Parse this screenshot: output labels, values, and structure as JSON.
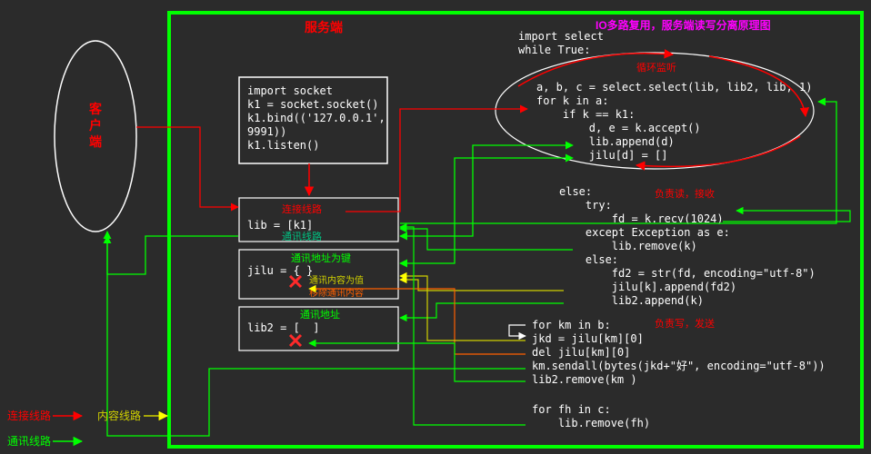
{
  "title_server": "服务端",
  "title_top_right": "IO多路复用，服务端读写分离原理图",
  "client_label": "客户端",
  "code_block1": {
    "l1": "import socket",
    "l2": "k1 = socket.socket()",
    "l3": "k1.bind(('127.0.0.1',",
    "l4": "9991))",
    "l5": "k1.listen()"
  },
  "mid": {
    "conn_line": "连接线路",
    "lib_line": "lib = [k1]",
    "comm_line": "通讯线路",
    "comm_addr_key": "通讯地址为键",
    "jilu_line": "jilu = { }",
    "comm_content_value": "通讯内容为值",
    "remove_comm_content": "移除通讯内容",
    "comm_addr": "通讯地址",
    "lib2_line": "lib2 = [  ]"
  },
  "top_code": {
    "l1": "import select",
    "l2": "while True:"
  },
  "ellipse": {
    "loop_label": "循环监听",
    "l1": "a, b, c = select.select(lib, lib2, lib, 1)",
    "l2": "for k in a:",
    "l3": "    if k == k1:",
    "l4": "        d, e = k.accept()",
    "l5": "        lib.append(d)",
    "l6": "        jilu[d] = []"
  },
  "block_read": {
    "else_label": "else:",
    "responsible_read": "负责读，接收",
    "l1": "    try:",
    "l2": "        fd = k.recv(1024)",
    "l3": "    except Exception as e:",
    "l4": "        lib.remove(k)",
    "l5": "    else:",
    "l6": "        fd2 = str(fd, encoding=\"utf-8\")",
    "l7": "        jilu[k].append(fd2)",
    "l8": "        lib2.append(k)"
  },
  "block_write": {
    "responsible_write": "负责写，发送",
    "l1": "for km in b:",
    "l2": "jkd = jilu[km][0]",
    "l3": "del jilu[km][0]",
    "l4": "km.sendall(bytes(jkd+\"好\", encoding=\"utf-8\"))",
    "l5": "lib2.remove(km )"
  },
  "block_err": {
    "l1": "for fh in c:",
    "l2": "    lib.remove(fh)"
  },
  "legend": {
    "conn_line": "连接线路",
    "content_line": "内容线路",
    "comm_line": "通讯线路"
  }
}
